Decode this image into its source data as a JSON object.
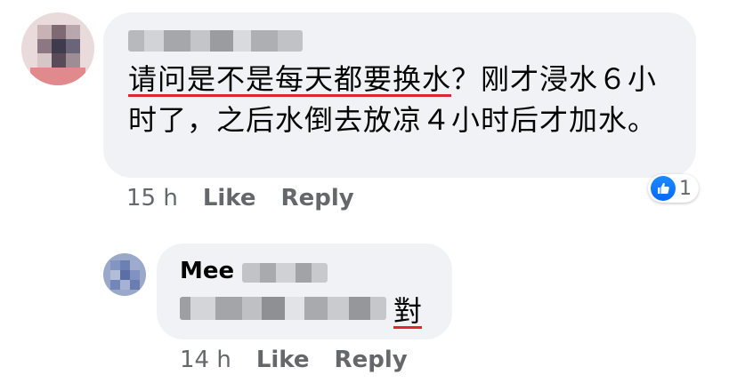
{
  "comments": [
    {
      "text_underlined": "请问是不是每天都要换水",
      "text_rest": "？刚才浸水６小时了，之后水倒去放凉４小时后才加水。",
      "timestamp": "15 h",
      "like_label": "Like",
      "reply_label": "Reply",
      "reaction_count": "1",
      "reaction_icon": "thumbs-up-icon"
    },
    {
      "author_visible": "Mee",
      "text": "對",
      "timestamp": "14 h",
      "like_label": "Like",
      "reply_label": "Reply"
    }
  ],
  "colors": {
    "bubble": "#f0f2f5",
    "meta_text": "#65676b",
    "like_blue": "#0866ff",
    "annotation_red": "#e0262e"
  }
}
